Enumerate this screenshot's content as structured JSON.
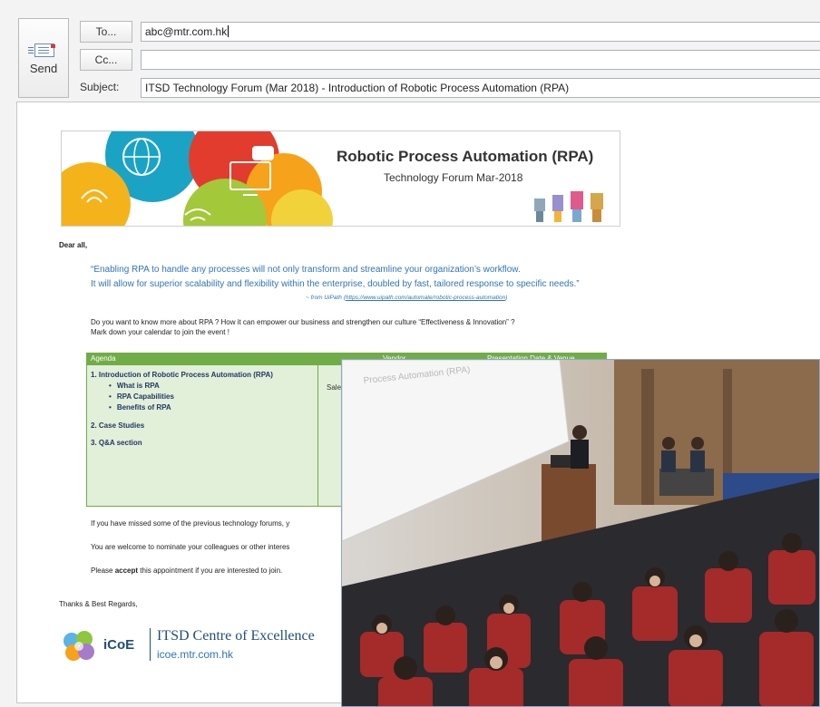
{
  "compose": {
    "send_label": "Send",
    "to_button": "To...",
    "cc_button": "Cc...",
    "subject_label": "Subject:",
    "to_value": "abc@mtr.com.hk",
    "cc_value": "",
    "subject_value": "ITSD Technology Forum (Mar 2018) - Introduction of Robotic Process Automation (RPA)"
  },
  "banner": {
    "title": "Robotic Process Automation (RPA)",
    "subtitle": "Technology Forum Mar-2018"
  },
  "body": {
    "greeting": "Dear all,",
    "quote_line1": "“Enabling RPA to handle any processes will not only transform and streamline your organization’s workflow.",
    "quote_line2": "It will allow for superior scalability and flexibility within the enterprise, doubled by fast, tailored response to specific needs.”",
    "source_prefix": "~ from UiPath (",
    "source_url": "https://www.uipath.com/automate/robotic-process-automation",
    "source_suffix": ")",
    "question_line1": "Do you want to know more about RPA ? How it can empower our business and strengthen our culture “Effectiveness & Innovation” ?",
    "question_line2": "Mark down your calendar to join the event !",
    "missed_text": "If you have missed some of the previous technology forums, y",
    "nominate_text": "You are welcome to nominate your colleagues or other interes",
    "accept_prefix": "Please ",
    "accept_bold": "accept",
    "accept_suffix": " this appointment if you are interested to join.",
    "regards": "Thanks & Best Regards,"
  },
  "agenda": {
    "headers": [
      "Agenda",
      "Vendor",
      "Presentation Date & Venue"
    ],
    "items": [
      {
        "label": "1.   Introduction of Robotic Process Automation (RPA)",
        "subs": [
          "What is RPA",
          "RPA Capabilities",
          "Benefits of RPA"
        ]
      },
      {
        "label": "2.   Case Studies",
        "subs": []
      },
      {
        "label": "3.   Q&A section",
        "subs": []
      }
    ],
    "vendor_value": "Sale"
  },
  "signature": {
    "brand": "iCoE",
    "name": "ITSD Centre of Excellence",
    "url": "icoe.mtr.com.hk"
  },
  "photo": {
    "screen_text": "Process Automation (RPA)"
  },
  "colors": {
    "agenda_green": "#70ad47",
    "agenda_bg": "#e2efd9",
    "quote_blue": "#2e75b6",
    "brand_navy": "#1f4e79"
  }
}
